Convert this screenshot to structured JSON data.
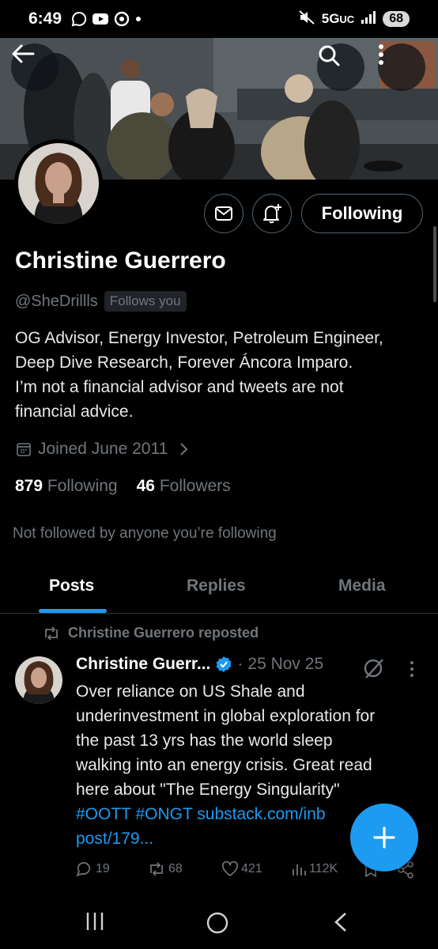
{
  "status_bar": {
    "time": "6:49",
    "network": "5G",
    "network_suffix": "UC",
    "battery": "68"
  },
  "profile": {
    "name": "Christine Guerrero",
    "handle": "@SheDrillls",
    "follows_you": "Follows you",
    "bio_lines": [
      "OG Advisor, Energy Investor, Petroleum Engineer,",
      "Deep Dive Research, Forever Áncora Imparo.",
      "I’m not a financial advisor and tweets are not",
      "financial advice."
    ],
    "joined": "Joined June 2011",
    "following_count": "879",
    "following_label": "Following",
    "followers_count": "46",
    "followers_label": "Followers",
    "not_followed": "Not followed by anyone you’re following"
  },
  "actions": {
    "following_button": "Following"
  },
  "tabs": [
    {
      "label": "Posts",
      "active": true
    },
    {
      "label": "Replies",
      "active": false
    },
    {
      "label": "Media",
      "active": false
    }
  ],
  "post": {
    "repost_label": "Christine Guerrero reposted",
    "author": "Christine Guerr...",
    "date_separator": "·",
    "date": "25 Nov 25",
    "text_lines": [
      "Over reliance on US Shale and",
      "underinvestment in global exploration for",
      "the past 13 yrs has the world sleep",
      "walking into an energy crisis. Great read",
      "here about \"The Energy Singularity\""
    ],
    "hashtag1": "#OOTT",
    "hashtag2": "#ONGT",
    "link_part1": "substack.com/inb",
    "link_part2": "post/179...",
    "replies": "19",
    "reposts": "68",
    "likes": "421",
    "views": "112K"
  },
  "colors": {
    "accent": "#1d9bf0",
    "background": "#000000",
    "text_primary": "#e7e9ea",
    "text_secondary": "#71767b"
  }
}
